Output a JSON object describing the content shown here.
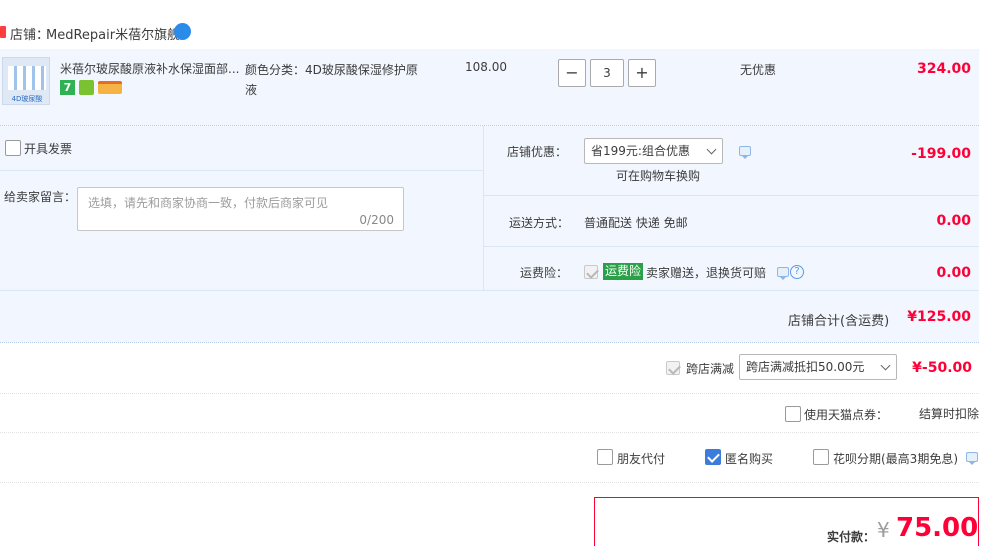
{
  "shop": {
    "label": "店铺：",
    "name": "MedRepair米蓓尔旗舰"
  },
  "item": {
    "title": "米蓓尔玻尿酸原液补水保湿面部...",
    "spec_label": "颜色分类：4D玻尿酸保湿修护原液",
    "unit_price": "108.00",
    "quantity": "3",
    "minus": "−",
    "plus": "+",
    "discount": "无优惠",
    "subtotal": "324.00",
    "badge_seven": "7",
    "thumb_caption": "4D玻尿酸"
  },
  "invoice": {
    "label": "开具发票"
  },
  "message": {
    "label": "给卖家留言：",
    "placeholder": "选填，请先和商家协商一致，付款后商家可见",
    "counter": "0/200"
  },
  "shop_promo": {
    "label": "店铺优惠：",
    "selected": "省199元:组合优惠",
    "note": "可在购物车换购",
    "amount": "-199.00"
  },
  "shipping": {
    "label": "运送方式：",
    "value": "普通配送 快递 免邮",
    "amount": "0.00"
  },
  "freight_insurance": {
    "label": "运费险：",
    "tag": "运费险",
    "value": "卖家赠送，退换货可赔",
    "amount": "0.00",
    "help": "?"
  },
  "shop_total": {
    "label": "店铺合计(含运费)",
    "amount": "¥125.00"
  },
  "cross_store": {
    "label": "跨店满减",
    "selected": "跨店满减抵扣50.00元",
    "amount": "¥-50.00"
  },
  "tmall_points": {
    "label": "使用天猫点券：",
    "value": "结算时扣除"
  },
  "options": {
    "friend_pay": "朋友代付",
    "anonymous": "匿名购买",
    "huabei": "花呗分期(最高3期免息)"
  },
  "payment": {
    "label": "实付款：",
    "currency": "¥",
    "amount": "75.00"
  },
  "colors": {
    "accent_red": "#ff0036",
    "panel_bg": "#f2f7ff",
    "checkbox_blue": "#3c7cdc",
    "tag_green": "#2aa148"
  }
}
